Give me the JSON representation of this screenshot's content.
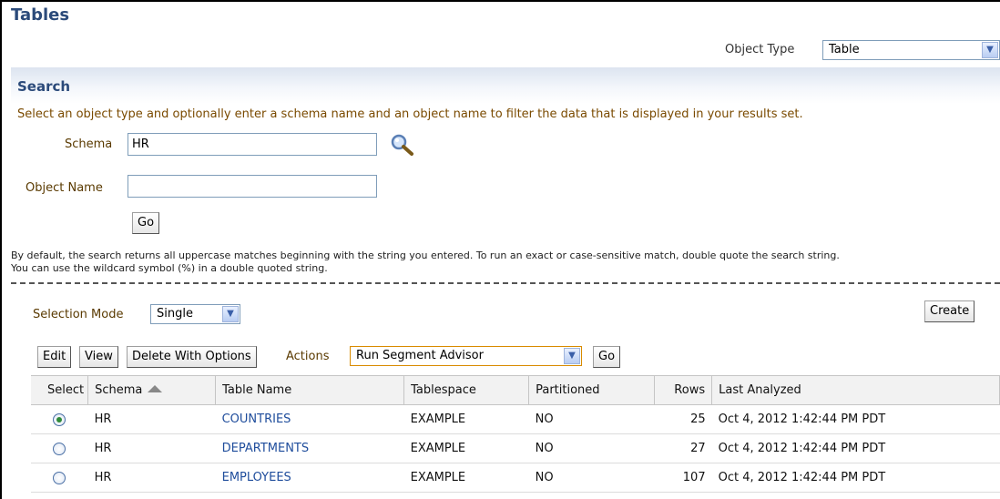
{
  "page": {
    "title": "Tables"
  },
  "object_type": {
    "label": "Object Type",
    "selected": "Table"
  },
  "search": {
    "heading": "Search",
    "instruction": "Select an object type and optionally enter a schema name and an object name to filter the data that is displayed in your results set.",
    "schema_label": "Schema",
    "schema_value": "HR",
    "object_name_label": "Object Name",
    "object_name_value": "",
    "go_label": "Go",
    "hint_line1": "By default, the search returns all uppercase matches beginning with the string you entered. To run an exact or case-sensitive match, double quote the search string.",
    "hint_line2": "You can use the wildcard symbol (%) in a double quoted string."
  },
  "selection_mode": {
    "label": "Selection Mode",
    "selected": "Single"
  },
  "create_label": "Create",
  "toolbar": {
    "edit": "Edit",
    "view": "View",
    "delete": "Delete With Options",
    "actions_label": "Actions",
    "actions_selected": "Run Segment Advisor",
    "go": "Go"
  },
  "table": {
    "columns": {
      "select": "Select",
      "schema": "Schema",
      "table_name": "Table Name",
      "tablespace": "Tablespace",
      "partitioned": "Partitioned",
      "rows": "Rows",
      "last_analyzed": "Last Analyzed"
    },
    "sort": {
      "column": "Schema",
      "direction": "ascending"
    },
    "rows": [
      {
        "selected": true,
        "schema": "HR",
        "table_name": "COUNTRIES",
        "tablespace": "EXAMPLE",
        "partitioned": "NO",
        "rows": "25",
        "last_analyzed": "Oct 4, 2012 1:42:44 PM PDT"
      },
      {
        "selected": false,
        "schema": "HR",
        "table_name": "DEPARTMENTS",
        "tablespace": "EXAMPLE",
        "partitioned": "NO",
        "rows": "27",
        "last_analyzed": "Oct 4, 2012 1:42:44 PM PDT"
      },
      {
        "selected": false,
        "schema": "HR",
        "table_name": "EMPLOYEES",
        "tablespace": "EXAMPLE",
        "partitioned": "NO",
        "rows": "107",
        "last_analyzed": "Oct 4, 2012 1:42:44 PM PDT"
      }
    ]
  }
}
